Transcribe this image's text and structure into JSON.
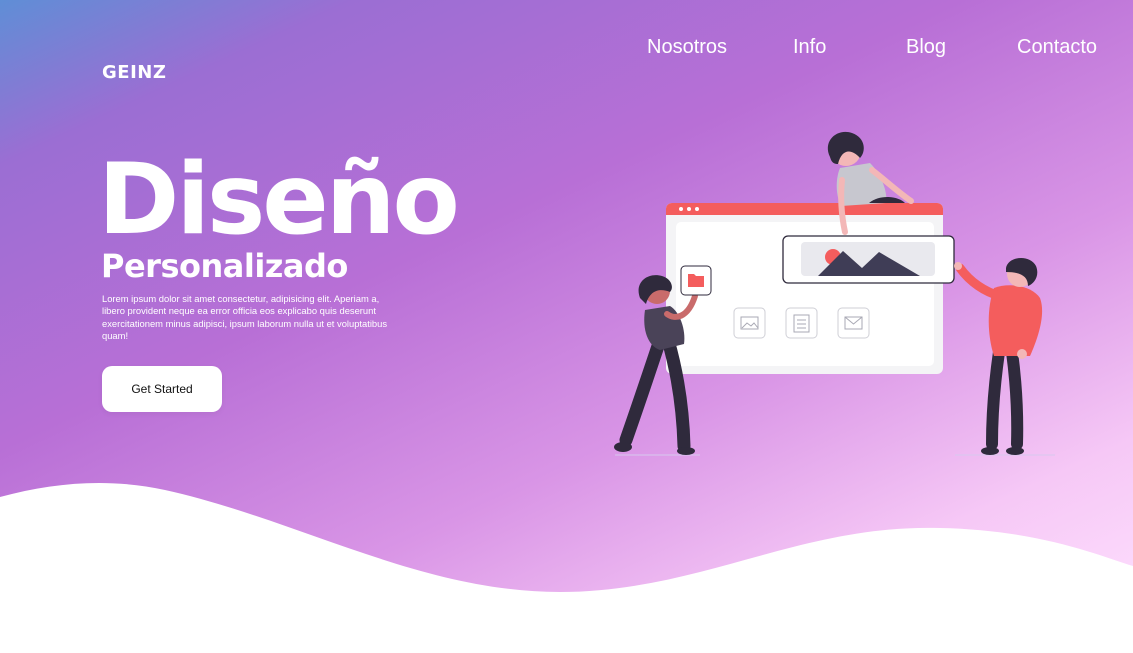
{
  "brand": {
    "logo_text": "GEINZ"
  },
  "nav": {
    "items": [
      {
        "label": "Nosotros"
      },
      {
        "label": "Info"
      },
      {
        "label": "Blog"
      },
      {
        "label": "Contacto"
      }
    ]
  },
  "hero": {
    "title": "Diseño",
    "subtitle": "Personalizado",
    "description": "Lorem ipsum dolor sit amet consectetur, adipisicing elit. Aperiam a, libero provident neque ea error officia eos explicabo quis deserunt exercitationem minus adipisci, ipsum laborum nulla ut et voluptatibus quam!",
    "cta_label": "Get Started"
  },
  "colors": {
    "accent": "#f45d5d",
    "dark": "#2f2a3c",
    "panel": "#f4f4f6"
  },
  "illustration": {
    "icons": [
      "folder-icon",
      "image-icon",
      "document-icon",
      "mail-icon",
      "picture-card-icon"
    ]
  }
}
